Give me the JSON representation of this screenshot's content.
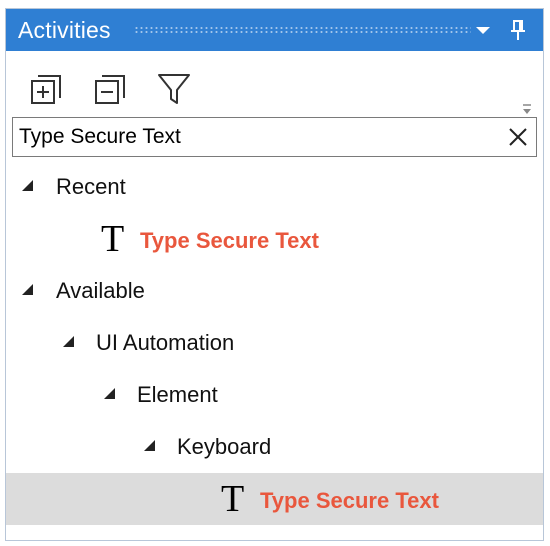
{
  "panel": {
    "title": "Activities",
    "titlebar_color": "#2f7fd3",
    "icons": {
      "menu": "dropdown-triangle-icon",
      "pin": "pin-icon"
    }
  },
  "toolbar": {
    "buttons": [
      {
        "name": "expand-all-button",
        "icon": "plus-square-icon"
      },
      {
        "name": "collapse-all-button",
        "icon": "minus-square-icon"
      },
      {
        "name": "filter-button",
        "icon": "funnel-icon"
      }
    ]
  },
  "search": {
    "value": "Type Secure Text",
    "clear_icon": "close-icon"
  },
  "tree": {
    "recent": {
      "label": "Recent",
      "activity": "Type Secure Text"
    },
    "available": {
      "label": "Available",
      "ui_automation": "UI Automation",
      "element": "Element",
      "keyboard": "Keyboard",
      "activity": "Type Secure Text"
    },
    "activity_icon": "T",
    "activity_color": "#e9573d",
    "selected_color": "#dcdcdc"
  }
}
